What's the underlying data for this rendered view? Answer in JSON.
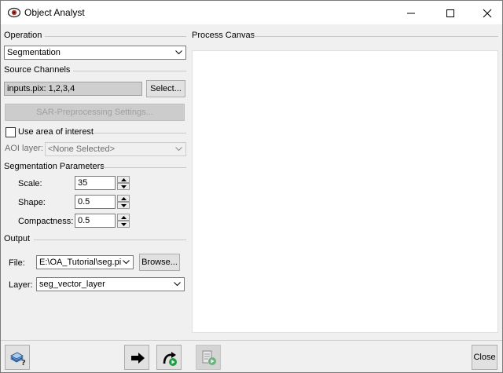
{
  "window": {
    "title": "Object Analyst"
  },
  "operation": {
    "label": "Operation",
    "selected": "Segmentation"
  },
  "source_channels": {
    "label": "Source Channels",
    "value": "inputs.pix: 1,2,3,4",
    "select_button": "Select..."
  },
  "sar_button": "SAR-Preprocessing Settings...",
  "aoi": {
    "checkbox_label": "Use area of interest",
    "layer_label": "AOI layer:",
    "layer_value": "<None Selected>"
  },
  "segmentation": {
    "label": "Segmentation Parameters",
    "scale_label": "Scale:",
    "scale_value": "35",
    "shape_label": "Shape:",
    "shape_value": "0.5",
    "compactness_label": "Compactness:",
    "compactness_value": "0.5"
  },
  "output": {
    "label": "Output",
    "file_label": "File:",
    "file_value": "E:\\OA_Tutorial\\seg.pi",
    "browse_button": "Browse...",
    "layer_label": "Layer:",
    "layer_value": "seg_vector_layer"
  },
  "canvas": {
    "label": "Process Canvas"
  },
  "footer": {
    "close_button": "Close"
  },
  "colors": {
    "accent_green": "#1e9e3e",
    "run_arrow": "#000000"
  }
}
